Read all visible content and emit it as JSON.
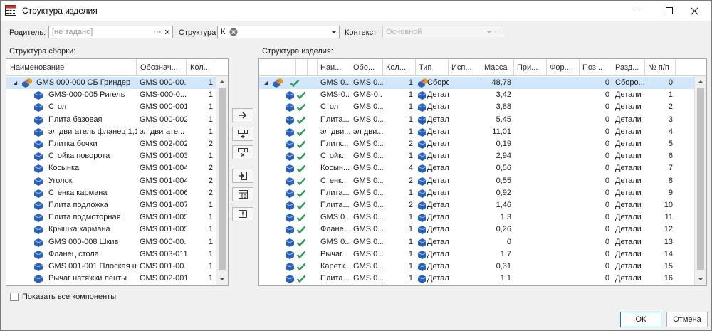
{
  "window": {
    "title": "Структура изделия",
    "close_glyph": "✕",
    "icon": "app-structure-icon"
  },
  "form": {
    "parent_label": "Родитель:",
    "parent_value": "[не задано]",
    "parent_dots": "···",
    "parent_clear": "✕",
    "structure_label": "Структура",
    "structure_value": "К",
    "context_label": "Контекст",
    "context_value": "Основной",
    "context_dots": "···"
  },
  "left": {
    "section_label": "Структура сборки:",
    "columns": [
      "Наименование",
      "Обознач...",
      "Кол..."
    ],
    "rows": [
      {
        "name": "GMS 000-000 СБ Гриндер",
        "code": "GMS 000-00...",
        "qty": "1",
        "level": 0,
        "kind": "assembly",
        "selected": true
      },
      {
        "name": "GMS-000-005 Ригель",
        "code": "GMS-000-0...",
        "qty": "1",
        "level": 1,
        "kind": "part"
      },
      {
        "name": "Стол",
        "code": "GMS 000-001",
        "qty": "1",
        "level": 1,
        "kind": "part"
      },
      {
        "name": "Плита базовая",
        "code": "GMS 000-002",
        "qty": "1",
        "level": 1,
        "kind": "part"
      },
      {
        "name": "эл двигатель фланец 1,1...",
        "code": "эл двигате...",
        "qty": "1",
        "level": 1,
        "kind": "part"
      },
      {
        "name": "Плитка бочки",
        "code": "GMS 002-002",
        "qty": "2",
        "level": 1,
        "kind": "part"
      },
      {
        "name": "Стойка поворота",
        "code": "GMS 001-003",
        "qty": "1",
        "level": 1,
        "kind": "part"
      },
      {
        "name": "Косынка",
        "code": "GMS 001-004",
        "qty": "2",
        "level": 1,
        "kind": "part"
      },
      {
        "name": "Уголок",
        "code": "GMS 001-004",
        "qty": "2",
        "level": 1,
        "kind": "part"
      },
      {
        "name": "Стенка кармана",
        "code": "GMS 001-006",
        "qty": "2",
        "level": 1,
        "kind": "part"
      },
      {
        "name": "Плита подложка",
        "code": "GMS 001-007",
        "qty": "1",
        "level": 1,
        "kind": "part"
      },
      {
        "name": "Плита подмоторная",
        "code": "GMS 001-005",
        "qty": "1",
        "level": 1,
        "kind": "part"
      },
      {
        "name": "Крышка кармана",
        "code": "GMS 001-005",
        "qty": "1",
        "level": 1,
        "kind": "part"
      },
      {
        "name": "GMS 000-008 Шкив",
        "code": "GMS 000-00...",
        "qty": "1",
        "level": 1,
        "kind": "part"
      },
      {
        "name": "Фланец стола",
        "code": "GMS 003-011",
        "qty": "1",
        "level": 1,
        "kind": "part"
      },
      {
        "name": "GMS 001-001 Плоская н...",
        "code": "GMS 001-00...",
        "qty": "1",
        "level": 1,
        "kind": "part"
      },
      {
        "name": "Рычаг натяжки ленты",
        "code": "GMS 002-001",
        "qty": "1",
        "level": 1,
        "kind": "part"
      }
    ],
    "show_all_label": "Показать все компоненты"
  },
  "right": {
    "section_label": "Структура изделия:",
    "columns": [
      "",
      "",
      "Наи...",
      "Обо...",
      "Кол...",
      "Тип",
      "Исп...",
      "Масса",
      "При...",
      "Фор...",
      "Поз...",
      "Разд...",
      "№ п/п"
    ],
    "rows": [
      {
        "name": "GMS 0...",
        "code": "GMS 0...",
        "qty": "1",
        "type": "Сборо...",
        "mass": "48,78",
        "pos": "0",
        "section": "Сборо...",
        "num": "0",
        "kind": "assembly",
        "selected": true
      },
      {
        "name": "GMS-0...",
        "code": "GMS-0...",
        "qty": "1",
        "type": "Детали",
        "mass": "3,42",
        "pos": "0",
        "section": "Детали",
        "num": "1",
        "kind": "part"
      },
      {
        "name": "Стол",
        "code": "GMS 0...",
        "qty": "1",
        "type": "Детали",
        "mass": "3,88",
        "pos": "0",
        "section": "Детали",
        "num": "2",
        "kind": "part"
      },
      {
        "name": "Плита...",
        "code": "GMS 0...",
        "qty": "1",
        "type": "Детали",
        "mass": "5,45",
        "pos": "0",
        "section": "Детали",
        "num": "3",
        "kind": "part"
      },
      {
        "name": "эл дви...",
        "code": "эл дви...",
        "qty": "1",
        "type": "Детали",
        "mass": "11,01",
        "pos": "0",
        "section": "Детали",
        "num": "4",
        "kind": "part"
      },
      {
        "name": "Плитк...",
        "code": "GMS 0...",
        "qty": "2",
        "type": "Детали",
        "mass": "0,19",
        "pos": "0",
        "section": "Детали",
        "num": "5",
        "kind": "part"
      },
      {
        "name": "Стойк...",
        "code": "GMS 0...",
        "qty": "1",
        "type": "Детали",
        "mass": "2,94",
        "pos": "0",
        "section": "Детали",
        "num": "6",
        "kind": "part"
      },
      {
        "name": "Косын...",
        "code": "GMS 0...",
        "qty": "4",
        "type": "Детали",
        "mass": "0,56",
        "pos": "0",
        "section": "Детали",
        "num": "7",
        "kind": "part"
      },
      {
        "name": "Стенк...",
        "code": "GMS 0...",
        "qty": "2",
        "type": "Детали",
        "mass": "0,55",
        "pos": "0",
        "section": "Детали",
        "num": "8",
        "kind": "part"
      },
      {
        "name": "Плита...",
        "code": "GMS 0...",
        "qty": "1",
        "type": "Детали",
        "mass": "0,92",
        "pos": "0",
        "section": "Детали",
        "num": "9",
        "kind": "part"
      },
      {
        "name": "Плита...",
        "code": "GMS 0...",
        "qty": "2",
        "type": "Детали",
        "mass": "1,46",
        "pos": "0",
        "section": "Детали",
        "num": "10",
        "kind": "part"
      },
      {
        "name": "GMS 0...",
        "code": "GMS 0...",
        "qty": "1",
        "type": "Детали",
        "mass": "1,3",
        "pos": "0",
        "section": "Детали",
        "num": "11",
        "kind": "part"
      },
      {
        "name": "Фланe...",
        "code": "GMS 0...",
        "qty": "1",
        "type": "Детали",
        "mass": "0,26",
        "pos": "0",
        "section": "Детали",
        "num": "12",
        "kind": "part"
      },
      {
        "name": "GMS 0...",
        "code": "GMS 0...",
        "qty": "1",
        "type": "Детали",
        "mass": "0",
        "pos": "0",
        "section": "Детали",
        "num": "13",
        "kind": "part"
      },
      {
        "name": "Рычаг...",
        "code": "GMS 0...",
        "qty": "1",
        "type": "Детали",
        "mass": "1,7",
        "pos": "0",
        "section": "Детали",
        "num": "14",
        "kind": "part"
      },
      {
        "name": "Каретк...",
        "code": "GMS 0...",
        "qty": "1",
        "type": "Детали",
        "mass": "0,31",
        "pos": "0",
        "section": "Детали",
        "num": "15",
        "kind": "part"
      },
      {
        "name": "Плита...",
        "code": "GMS 0...",
        "qty": "1",
        "type": "Детали",
        "mass": "1,1",
        "pos": "0",
        "section": "Детали",
        "num": "16",
        "kind": "part"
      }
    ]
  },
  "tools": [
    {
      "name": "add-to-structure-button",
      "icon": "arrow-right-icon"
    },
    {
      "name": "insert-row-button",
      "icon": "table-add-icon"
    },
    {
      "name": "delete-row-button",
      "icon": "table-remove-icon"
    },
    {
      "name": "export-button",
      "icon": "export-icon"
    },
    {
      "name": "table-settings-button",
      "icon": "table-settings-icon"
    },
    {
      "name": "check-button",
      "icon": "warning-icon"
    }
  ],
  "buttons": {
    "ok": "ОК",
    "cancel": "Отмена"
  },
  "colors": {
    "accent": "#0078d7",
    "selection": "#d3e7fb",
    "check": "#2e9b57",
    "part_blue": "#2b63b8",
    "assembly_orange": "#e59a2a"
  }
}
